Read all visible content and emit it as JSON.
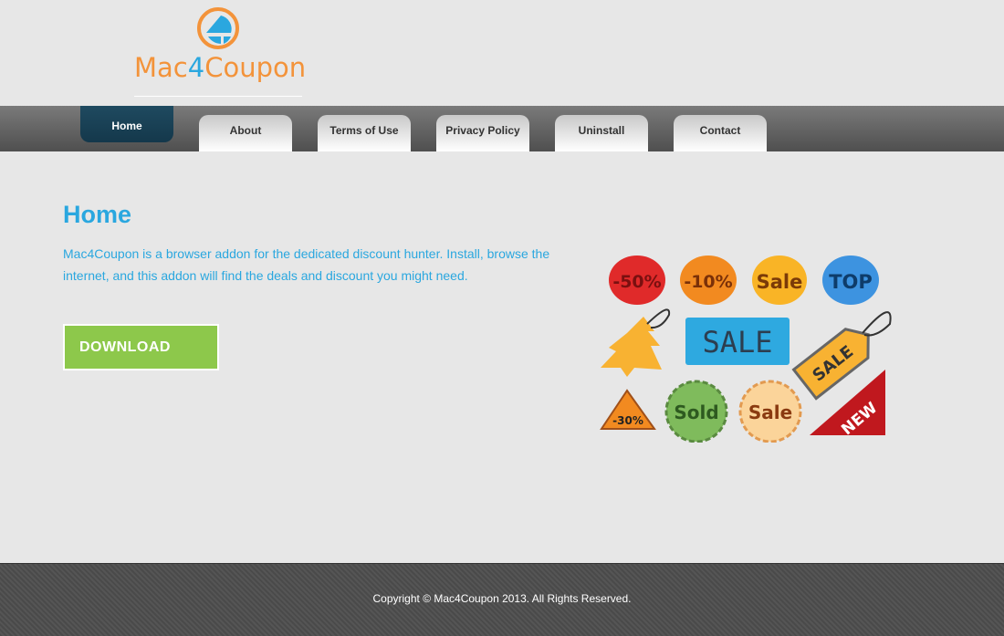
{
  "logo": {
    "text_main": "Mac",
    "text_four": "4",
    "text_end": "Coupon",
    "colors": {
      "orange": "#f3933a",
      "blue": "#2aa7df"
    }
  },
  "nav": {
    "items": [
      {
        "label": "Home",
        "active": true
      },
      {
        "label": "About"
      },
      {
        "label": "Terms of Use"
      },
      {
        "label": "Privacy Policy"
      },
      {
        "label": "Uninstall"
      },
      {
        "label": "Contact"
      }
    ]
  },
  "main": {
    "title": "Home",
    "description": "Mac4Coupon is a browser addon for the dedicated discount hunter. Install, browse the internet, and this addon will find the deals and discount you might need.",
    "download_label": "DOWNLOAD"
  },
  "art": {
    "labels": [
      "-50%",
      "-10%",
      "Sale",
      "TOP",
      "SALE",
      "SALE",
      "-30%",
      "Sold",
      "Sale",
      "NEW"
    ]
  },
  "footer": {
    "copyright": "Copyright © Mac4Coupon 2013. All Rights Reserved."
  }
}
